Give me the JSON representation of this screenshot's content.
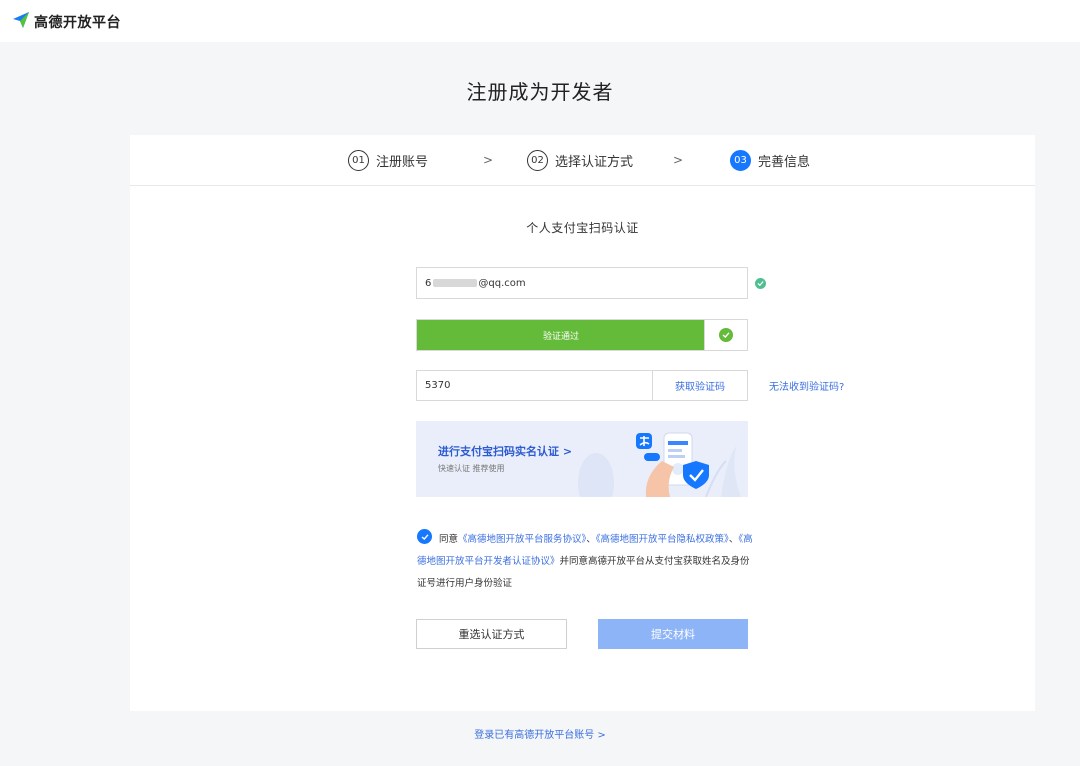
{
  "header": {
    "logo_text": "高德开放平台"
  },
  "page_title": "注册成为开发者",
  "steps": [
    {
      "num": "01",
      "label": "注册账号",
      "active": false
    },
    {
      "num": "02",
      "label": "选择认证方式",
      "active": false
    },
    {
      "num": "03",
      "label": "完善信息",
      "active": true
    }
  ],
  "step_separator": ">",
  "form": {
    "title": "个人支付宝扫码认证",
    "email": {
      "prefix": "6",
      "suffix": "@qq.com",
      "status_icon": "check-circle-icon"
    },
    "slider": {
      "label": "验证通过",
      "progress": 1.0
    },
    "code": {
      "value": "5370",
      "button_label": "获取验证码"
    },
    "no_code_link": "无法收到验证码?",
    "banner": {
      "title": "进行支付宝扫码实名认证 >",
      "subtitle": "快速认证 推荐使用"
    },
    "agreement": {
      "prefix": "同意",
      "link1": "《高德地图开放平台服务协议》",
      "sep1": "、",
      "link2": "《高德地图开放平台隐私权政策》",
      "sep2": "、",
      "link3": "《高德地图开放平台开发者认证协议》",
      "suffix": "并同意高德开放平台从支付宝获取姓名及身份证号进行用户身份验证"
    },
    "buttons": {
      "reselect": "重选认证方式",
      "submit": "提交材料"
    }
  },
  "footer": {
    "login_link": "登录已有高德开放平台账号 >"
  },
  "colors": {
    "primary": "#1677ff",
    "link": "#3b6fe0",
    "success": "#64ba39",
    "submit_disabled": "#8eb4f8"
  }
}
